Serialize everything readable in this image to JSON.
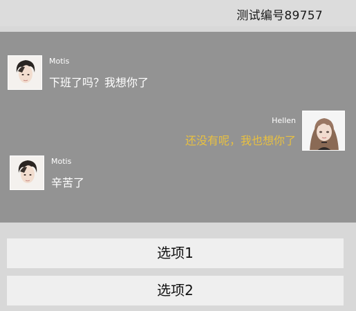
{
  "header": {
    "title": "测试编号89757"
  },
  "messages": [
    {
      "sender": "Motis",
      "text": "下班了吗？我想你了",
      "side": "left",
      "text_color": "#ffffff"
    },
    {
      "sender": "Hellen",
      "text": "还没有呢，我也想你了",
      "side": "right",
      "text_color": "#e8c040"
    },
    {
      "sender": "Motis",
      "text": "辛苦了",
      "side": "left",
      "text_color": "#ffffff"
    }
  ],
  "options": [
    {
      "label": "选项1"
    },
    {
      "label": "选项2"
    }
  ],
  "colors": {
    "chat_background": "#939393",
    "page_background": "#d8d8d8",
    "option_background": "#efefef",
    "reply_text": "#e8c040"
  }
}
